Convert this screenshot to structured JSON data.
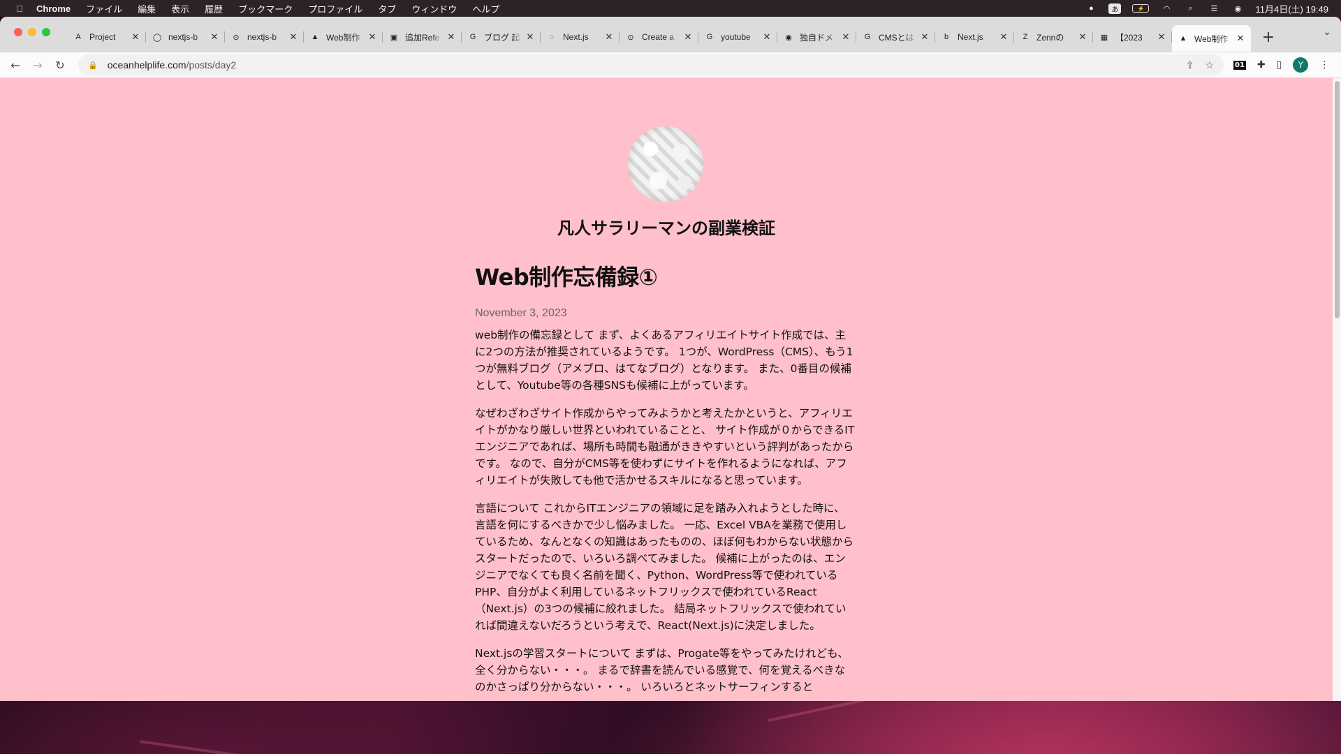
{
  "menubar": {
    "app": "Chrome",
    "items": [
      "ファイル",
      "編集",
      "表示",
      "履歴",
      "ブックマーク",
      "プロファイル",
      "タブ",
      "ウィンドウ",
      "ヘルプ"
    ],
    "ime": "あ",
    "clock": "11月4日(土) 19:49"
  },
  "tabs": [
    {
      "title": "Project",
      "icon": "A"
    },
    {
      "title": "nextjs-b",
      "icon": "◯"
    },
    {
      "title": "nextjs-b",
      "icon": "⊙"
    },
    {
      "title": "Web制作",
      "icon": "▲"
    },
    {
      "title": "追加Refe",
      "icon": "▣"
    },
    {
      "title": "ブログ 起",
      "icon": "G"
    },
    {
      "title": "Next.js",
      "icon": "◌"
    },
    {
      "title": "Create a",
      "icon": "⊙"
    },
    {
      "title": "youtube",
      "icon": "G"
    },
    {
      "title": "独自ドメ",
      "icon": "◉"
    },
    {
      "title": "CMSとは",
      "icon": "G"
    },
    {
      "title": "Next.js",
      "icon": "b"
    },
    {
      "title": "Zennの",
      "icon": "Z"
    },
    {
      "title": "【2023",
      "icon": "▦"
    },
    {
      "title": "Web制作",
      "icon": "▲",
      "active": true
    }
  ],
  "address": {
    "domain": "oceanhelplife.com",
    "path": "/posts/day2"
  },
  "profile_initial": "Y",
  "ext_label": "01",
  "site": {
    "title": "凡人サラリーマンの副業検証"
  },
  "post": {
    "title": "Web制作忘備録①",
    "date": "November 3, 2023",
    "paragraphs": [
      "web制作の備忘録として まず、よくあるアフィリエイトサイト作成では、主に2つの方法が推奨されているようです。 1つが、WordPress（CMS）、もう1つが無料ブログ（アメブロ、はてなブログ）となります。 また、0番目の候補として、Youtube等の各種SNSも候補に上がっています。",
      "なぜわざわざサイト作成からやってみようかと考えたかというと、アフィリエイトがかなり厳しい世界といわれていることと、 サイト作成が０からできるITエンジニアであれば、場所も時間も融通がききやすいという評判があったからです。 なので、自分がCMS等を使わずにサイトを作れるようになれば、アフィリエイトが失敗しても他で活かせるスキルになると思っています。",
      "言語について これからITエンジニアの領域に足を踏み入れようとした時に、言語を何にするべきかで少し悩みました。 一応、Excel VBAを業務で使用しているため、なんとなくの知識はあったものの、ほぼ何もわからない状態からスタートだったので、いろいろ調べてみました。 候補に上がったのは、エンジニアでなくても良く名前を聞く、Python、WordPress等で使われているPHP、自分がよく利用しているネットフリックスで使われているReact（Next.js）の3つの候補に絞れました。 結局ネットフリックスで使われていれば間違えないだろうという考えで、React(Next.js)に決定しました。",
      "Next.jsの学習スタートについて まずは、Progate等をやってみたけれども、全く分からない・・・。 まるで辞書を読んでいる感覚で、何を覚えるべきなのかさっぱり分からない・・・。 いろいろとネットサーフィンすると"
    ]
  }
}
